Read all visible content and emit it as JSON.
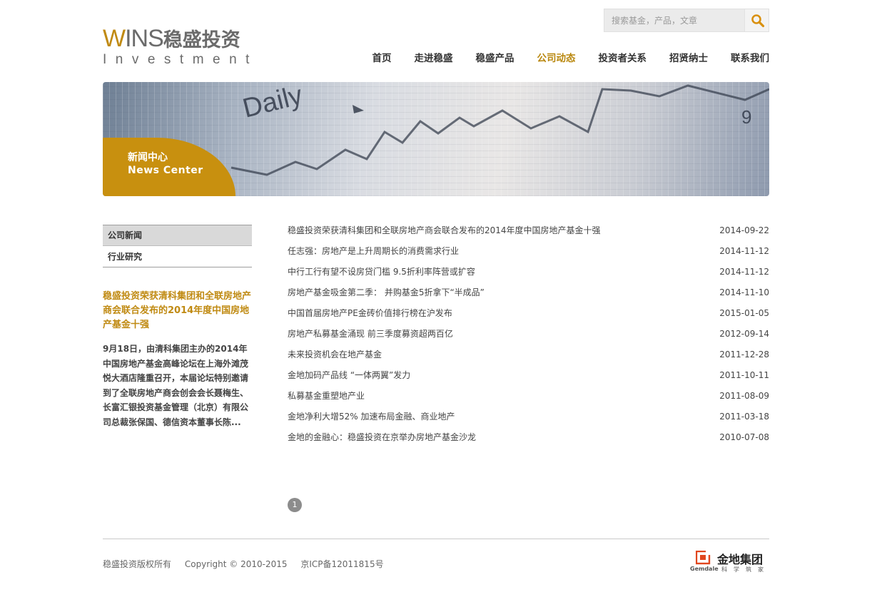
{
  "logo": {
    "wins_w": "W",
    "wins_rest": "INS",
    "cn": "稳盛投资",
    "en": "Investment"
  },
  "search": {
    "placeholder": "搜索基金，产品，文章",
    "icon": "search-icon"
  },
  "nav": {
    "items": [
      {
        "label": "首页"
      },
      {
        "label": "走进稳盛"
      },
      {
        "label": "稳盛产品"
      },
      {
        "label": "公司动态"
      },
      {
        "label": "投资者关系"
      },
      {
        "label": "招贤纳士"
      },
      {
        "label": "联系我们"
      }
    ],
    "active_index": 3
  },
  "banner": {
    "title_cn": "新闻中心",
    "title_en": "News Center"
  },
  "sidebar": {
    "menu": [
      {
        "label": "公司新闻"
      },
      {
        "label": "行业研究"
      }
    ],
    "feature_title": "稳盛投资荣获清科集团和全联房地产商会联合发布的2014年度中国房地产基金十强",
    "feature_summary": "9月18日，由清科集团主办的2014年中国房地产基金高峰论坛在上海外滩茂悦大酒店隆重召开，本届论坛特别邀请到了全联房地产商会创会会长聂梅生、长富汇银投资基金管理（北京）有限公司总裁张保国、德信资本董事长陈..."
  },
  "news": [
    {
      "title": "稳盛投资荣获清科集团和全联房地产商会联合发布的2014年度中国房地产基金十强",
      "date": "2014-09-22"
    },
    {
      "title": "任志强：房地产是上升周期长的消费需求行业",
      "date": "2014-11-12"
    },
    {
      "title": "中行工行有望不设房贷门槛 9.5折利率阵营或扩容",
      "date": "2014-11-12"
    },
    {
      "title": "房地产基金吸金第二季： 并购基金5折拿下“半成品”",
      "date": "2014-11-10"
    },
    {
      "title": "中国首届房地产PE金砖价值排行榜在沪发布",
      "date": "2015-01-05"
    },
    {
      "title": "房地产私募基金涌现 前三季度募资超两百亿",
      "date": "2012-09-14"
    },
    {
      "title": "未来投资机会在地产基金",
      "date": "2011-12-28"
    },
    {
      "title": "金地加码产品线 “一体两翼”发力",
      "date": "2011-10-11"
    },
    {
      "title": "私募基金重塑地产业",
      "date": "2011-08-09"
    },
    {
      "title": "金地净利大增52% 加速布局金融、商业地产",
      "date": "2011-03-18"
    },
    {
      "title": "金地的金融心：稳盛投资在京举办房地产基金沙龙",
      "date": "2010-07-08"
    }
  ],
  "pager": {
    "current": "1"
  },
  "footer": {
    "copyright_cn": "稳盛投资版权所有",
    "copyright_en": "Copyright © 2010-2015",
    "icp": "京ICP备12011815号"
  },
  "partner": {
    "name_cn": "金地集团",
    "name_en": "Gemdale",
    "slogan": "科学筑家"
  },
  "colors": {
    "accent": "#c08a12",
    "badge": "#c8900f",
    "text": "#444444"
  }
}
